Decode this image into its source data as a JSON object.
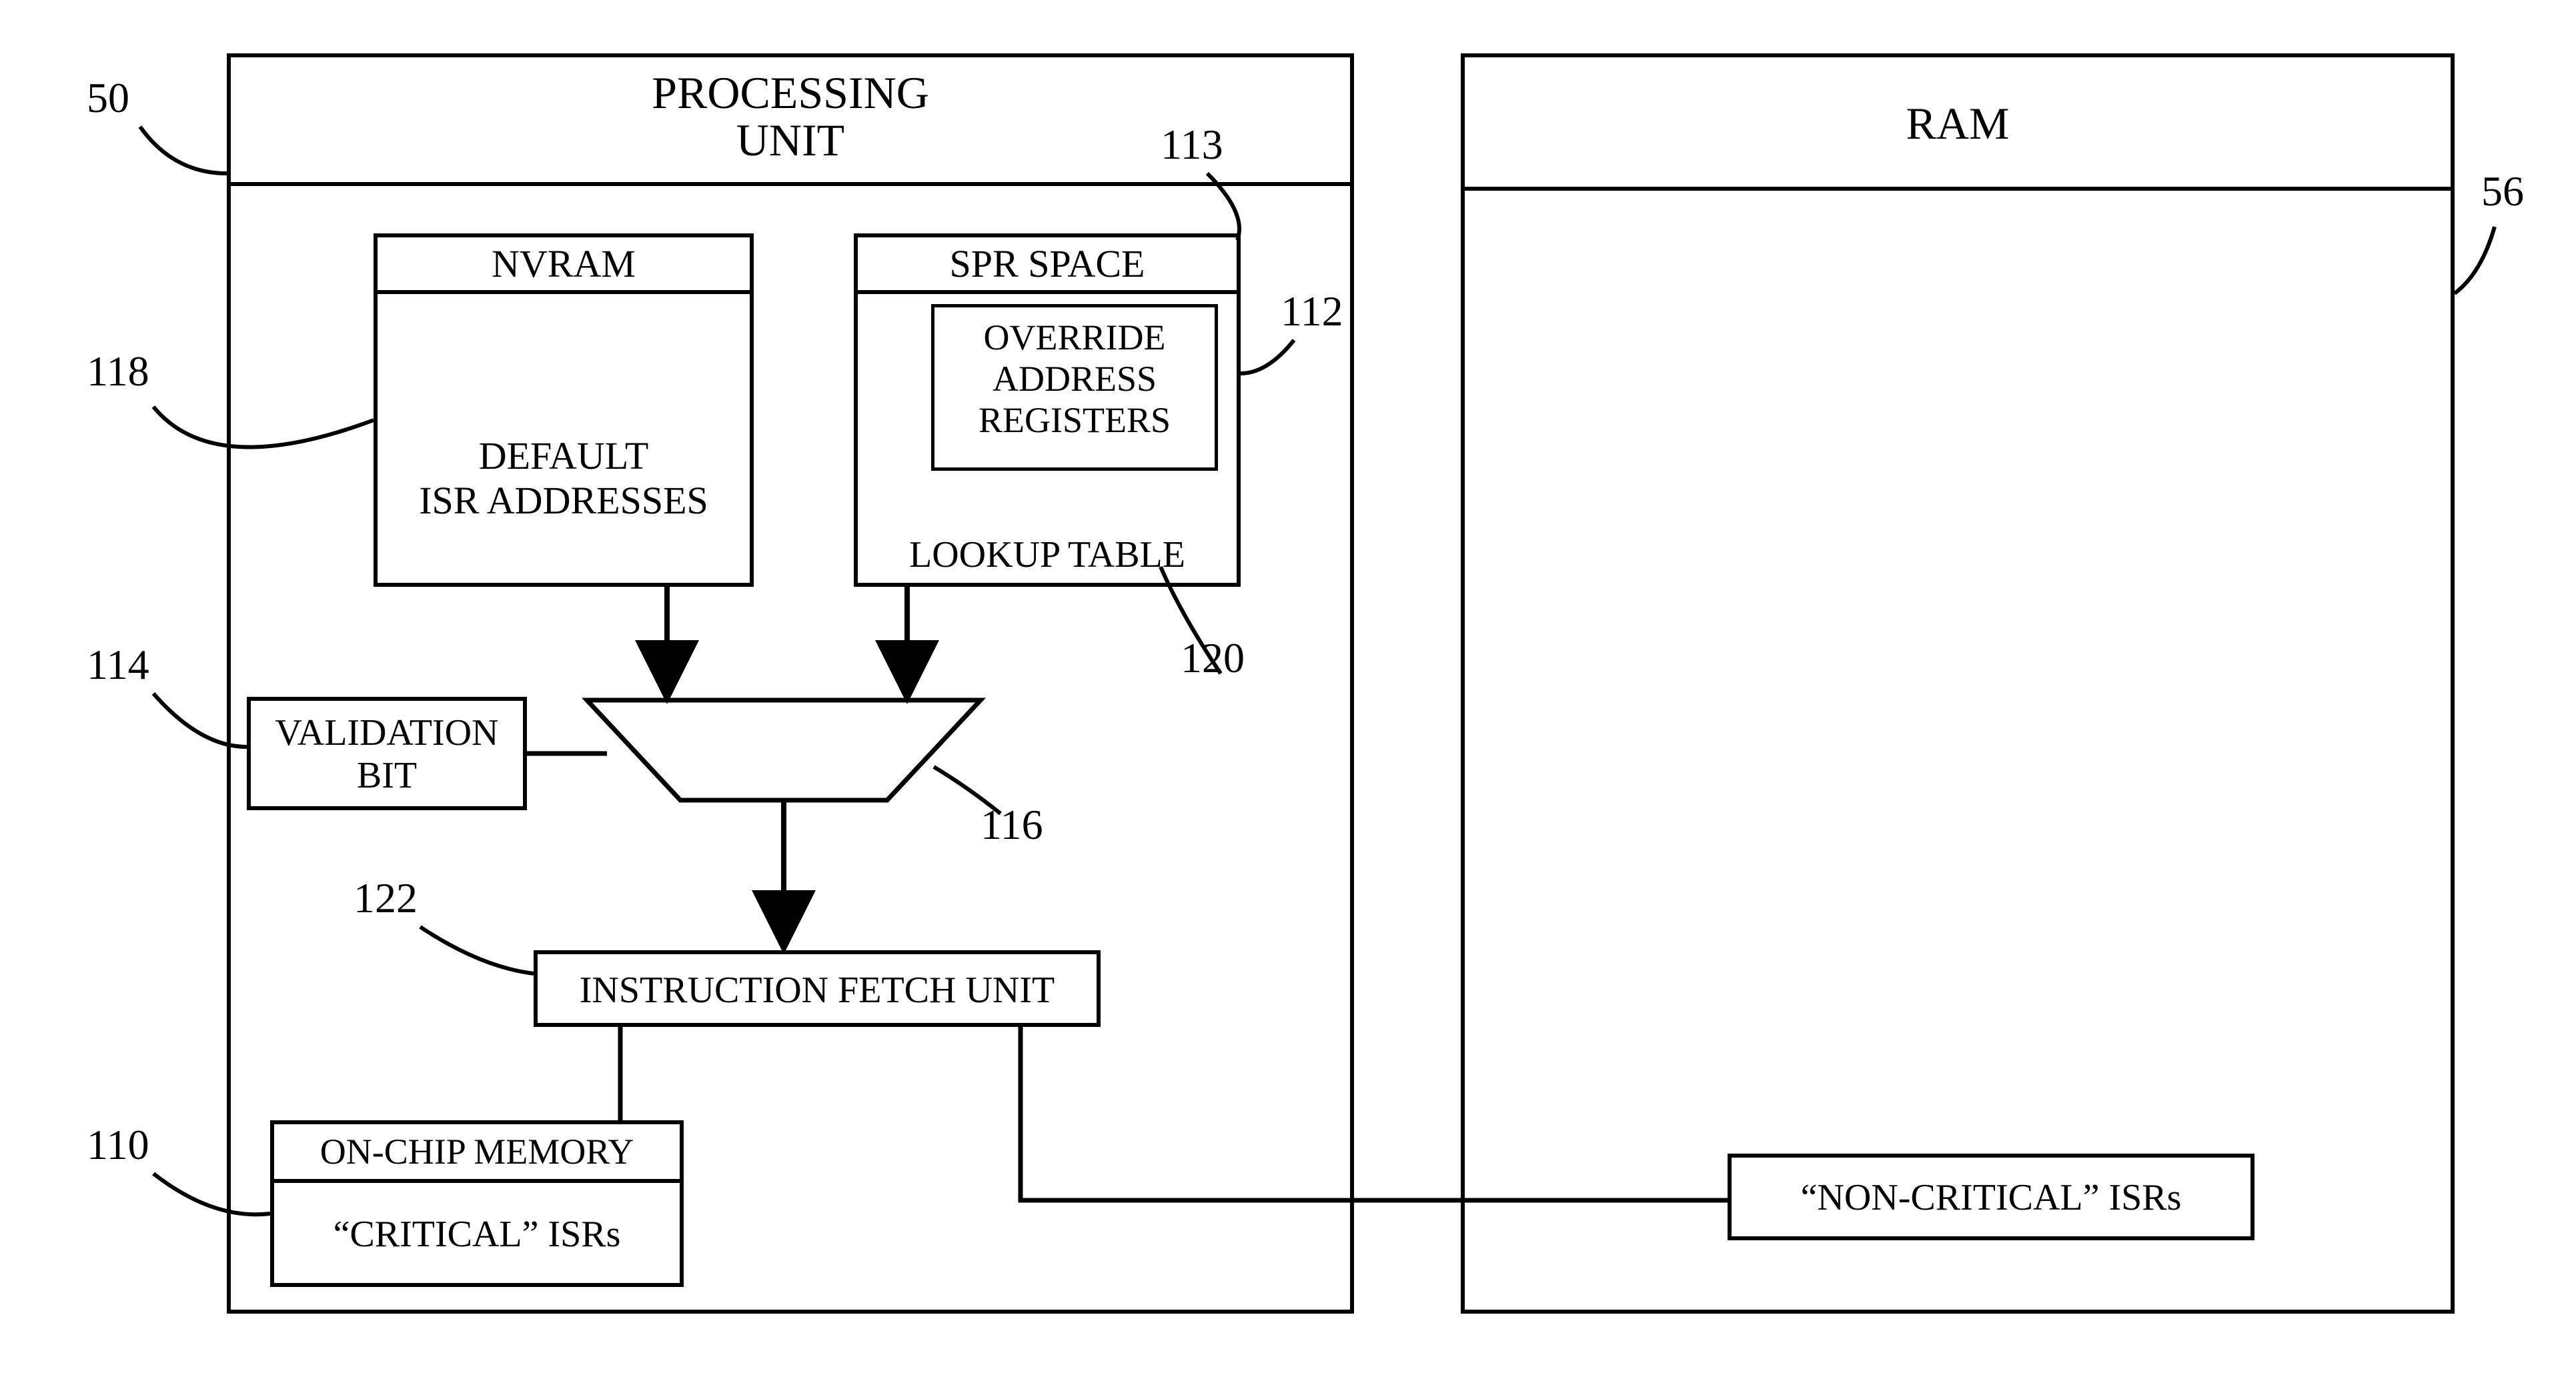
{
  "processingUnit": {
    "title": "PROCESSING\nUNIT",
    "titleLine1": "PROCESSING",
    "titleLine2": "UNIT"
  },
  "ram": {
    "title": "RAM"
  },
  "nvram": {
    "title": "NVRAM",
    "content1": "DEFAULT",
    "content2": "ISR ADDRESSES"
  },
  "sprSpace": {
    "title": "SPR SPACE",
    "overrideBox": {
      "line1": "OVERRIDE",
      "line2": "ADDRESS",
      "line3": "REGISTERS"
    },
    "lookup": "LOOKUP TABLE"
  },
  "validationBit": {
    "line1": "VALIDATION",
    "line2": "BIT"
  },
  "instructionFetch": {
    "label": "INSTRUCTION FETCH UNIT"
  },
  "onChipMemory": {
    "title": "ON-CHIP MEMORY",
    "content": "“CRITICAL” ISRs"
  },
  "nonCriticalIsrs": {
    "label": "“NON-CRITICAL” ISRs"
  },
  "refs": {
    "r50": "50",
    "r56": "56",
    "r110": "110",
    "r112": "112",
    "r113": "113",
    "r114": "114",
    "r116": "116",
    "r118": "118",
    "r120": "120",
    "r122": "122"
  }
}
